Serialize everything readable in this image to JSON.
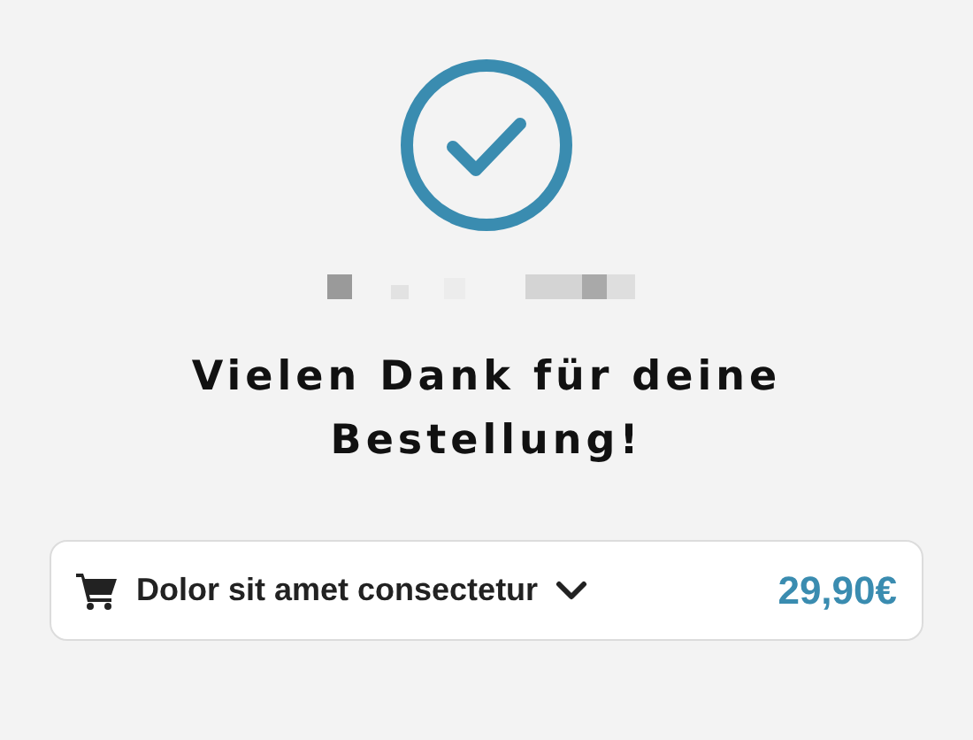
{
  "heading": "Vielen Dank für deine Bestellung!",
  "order": {
    "product": "Dolor sit amet consectetur",
    "price": "29,90€",
    "expanded": false
  }
}
